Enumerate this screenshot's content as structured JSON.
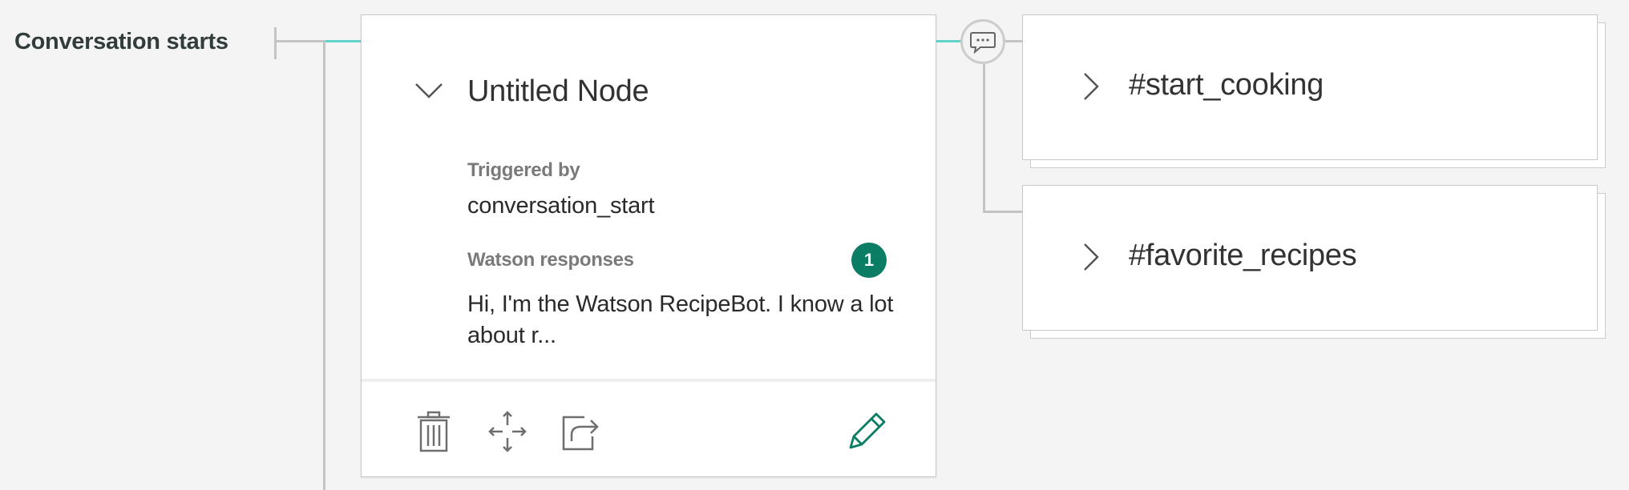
{
  "flow": {
    "start_label": "Conversation starts"
  },
  "node": {
    "title": "Untitled Node",
    "triggered_by_label": "Triggered by",
    "trigger_value": "conversation_start",
    "responses_label": "Watson responses",
    "responses_count": "1",
    "response_preview": "Hi, I'm the Watson RecipeBot. I know a lot about r..."
  },
  "children": [
    {
      "title": "#start_cooking"
    },
    {
      "title": "#favorite_recipes"
    }
  ],
  "colors": {
    "accent": "#0a7d64",
    "connector_active": "#5fd4c8",
    "connector": "#c4c4c4",
    "background": "#f4f4f4"
  },
  "icons": {
    "collapse": "chevron-down-icon",
    "expand": "chevron-right-icon",
    "delete": "trash-icon",
    "move": "move-arrows-icon",
    "jump": "jump-to-icon",
    "edit": "pencil-icon",
    "response": "speech-bubble-icon"
  }
}
